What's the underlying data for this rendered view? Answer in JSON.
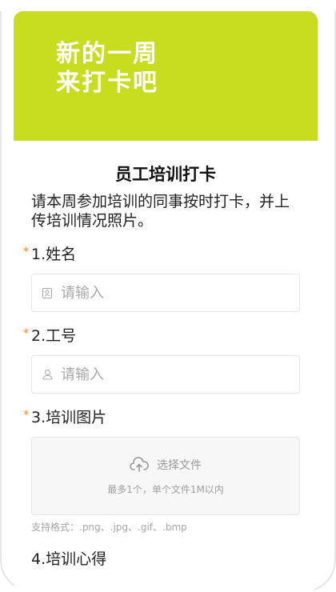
{
  "banner": {
    "line1": "新的一周",
    "line2": "来打卡吧",
    "color": "#c8dc20"
  },
  "form": {
    "title": "员工培训打卡",
    "description": "请本周参加培训的同事按时打卡，并上传培训情况照片。"
  },
  "questions": [
    {
      "label": "1.姓名",
      "required": true,
      "placeholder": "请输入",
      "icon": "id-card-icon"
    },
    {
      "label": "2.工号",
      "required": true,
      "placeholder": "请输入",
      "icon": "person-icon"
    },
    {
      "label": "3.培训图片",
      "required": true,
      "upload_label": "选择文件",
      "upload_hint": "最多1个，单个文件1M以内",
      "formats": "支持格式：.png、.jpg、.gif、.bmp",
      "icon": "cloud-upload-icon"
    },
    {
      "label": "4.培训心得",
      "required": false
    }
  ],
  "required_mark": "*",
  "colors": {
    "required": "#f08a3c",
    "banner_text": "#ffffff"
  }
}
